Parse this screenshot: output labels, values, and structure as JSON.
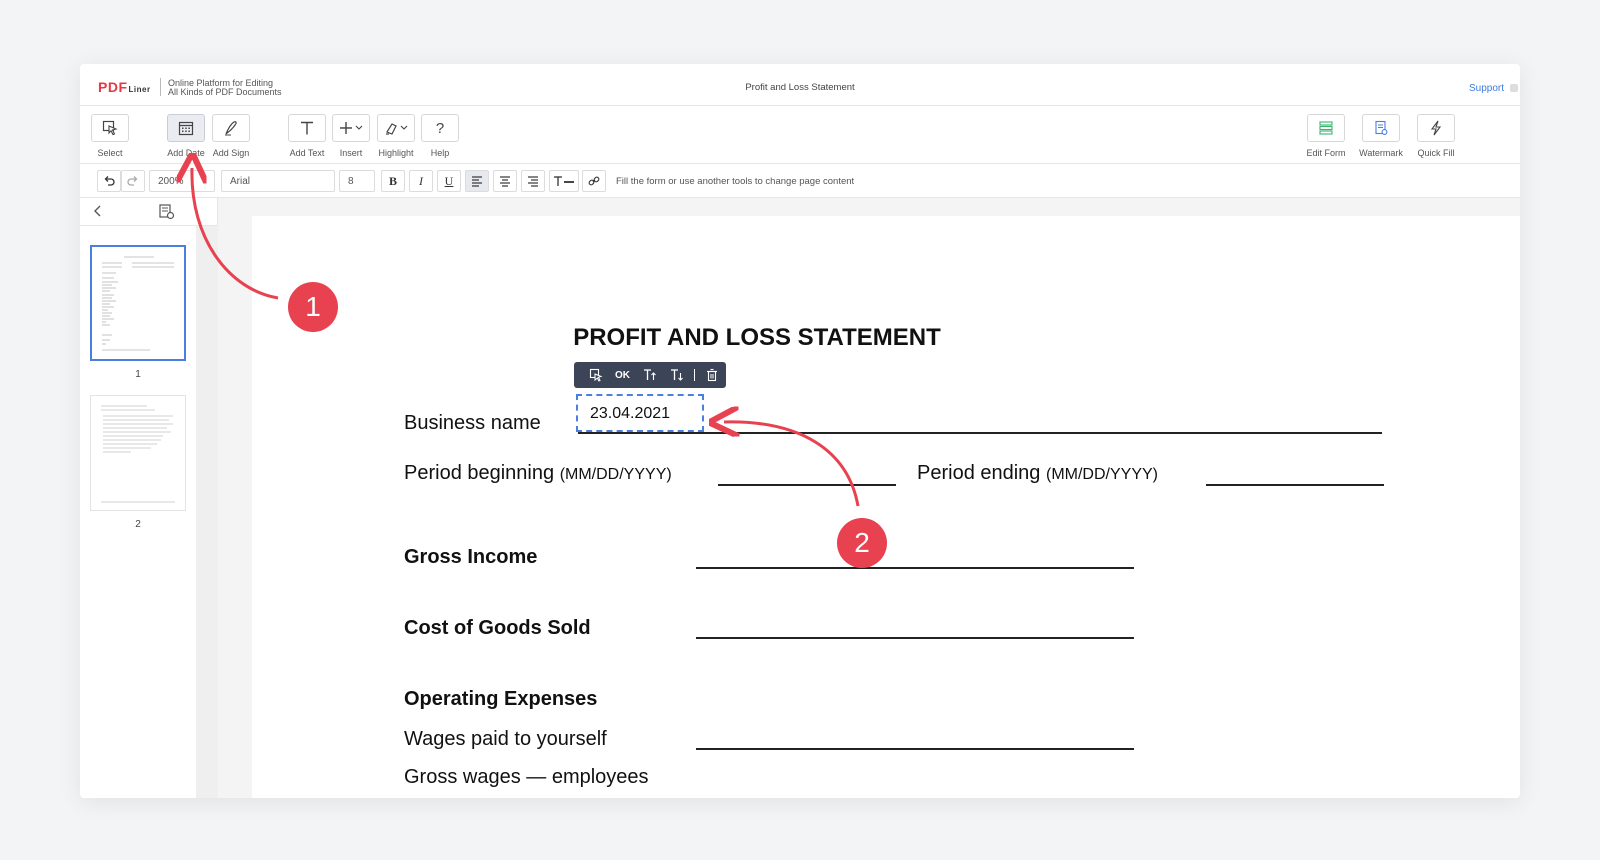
{
  "header": {
    "logo_main": "PDF",
    "logo_sub": "Liner",
    "tagline_1": "Online Platform for Editing",
    "tagline_2": "All Kinds of PDF Documents",
    "doc_title": "Profit and Loss Statement",
    "support_label": "Support"
  },
  "toolbar": {
    "select": "Select",
    "add_date": "Add Date",
    "add_sign": "Add Sign",
    "add_text": "Add Text",
    "insert": "Insert",
    "highlight": "Highlight",
    "help": "Help",
    "edit_form": "Edit Form",
    "watermark": "Watermark",
    "quick_fill": "Quick Fill"
  },
  "formatbar": {
    "zoom": "200%",
    "font": "Arial",
    "font_size": "8",
    "bold": "B",
    "italic": "I",
    "underline": "U",
    "hint": "Fill the form or use another tools to change page content"
  },
  "sidebar": {
    "pages": [
      "1",
      "2"
    ]
  },
  "document": {
    "heading": "PROFIT AND LOSS STATEMENT",
    "business_name": "Business name",
    "period_beginning": "Period beginning",
    "period_ending": "Period ending",
    "date_format": "(MM/DD/YYYY)",
    "gross_income": "Gross Income",
    "cost_of_goods": "Cost of Goods Sold",
    "operating_expenses": "Operating Expenses",
    "wages_yourself": "Wages paid to yourself",
    "gross_wages": "Gross wages — employees",
    "date_value": "23.04.2021"
  },
  "popbar": {
    "ok": "OK"
  },
  "callouts": [
    "1",
    "2"
  ],
  "colors": {
    "accent_blue": "#4a7fe0",
    "callout_red": "#e8414f",
    "brand_red": "#e53945"
  }
}
